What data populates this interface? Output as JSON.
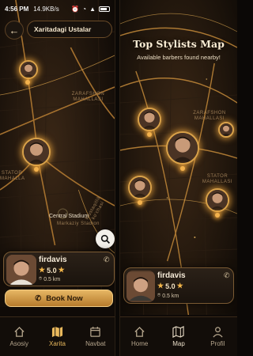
{
  "left_screen": {
    "status": {
      "time": "4:56 PM",
      "network": "14.9KB/s",
      "icons": [
        "alarm-icon",
        "wifi-icon",
        "signal-icon",
        "battery-icon"
      ]
    },
    "header": {
      "back_icon": "arrow-left-icon",
      "title": "Xaritadagi Ustalar"
    },
    "map_labels": {
      "district1": "ZARAFSHON MAHALLASI",
      "district2": "STATOR MAHALLA",
      "stadium": "Central Stadium",
      "stadium_sub": "Markaziy Stadion",
      "street": "Mustaqillik ko'chasi"
    },
    "search_icon": "search-icon",
    "card": {
      "name": "firdavis",
      "rating": "5.0",
      "stars": "★★",
      "distance": "0.5 km",
      "phone_icon": "phone-icon",
      "pin_icon": "location-pin-icon"
    },
    "book_button": {
      "label": "Book Now",
      "icon": "phone-icon"
    },
    "nav": [
      {
        "label": "Asosiy",
        "icon": "home-icon",
        "active": false
      },
      {
        "label": "Xarita",
        "icon": "map-icon",
        "active": true
      },
      {
        "label": "Navbat",
        "icon": "calendar-icon",
        "active": false
      }
    ]
  },
  "right_screen": {
    "title": "Top Stylists Map",
    "subtitle": "Available barbers found nearby!",
    "map_labels": {
      "district1": "ZARAFSHON MAHALLASI",
      "district2": "STATOR MAHALLASI"
    },
    "card": {
      "name": "firdavis",
      "rating": "5.0",
      "stars": "★★",
      "distance": "0.5 km",
      "phone_icon": "phone-icon"
    },
    "nav": [
      {
        "label": "Home",
        "icon": "home-icon",
        "active": false
      },
      {
        "label": "Map",
        "icon": "map-icon",
        "active": true
      },
      {
        "label": "Profil",
        "icon": "person-icon",
        "active": false
      }
    ]
  },
  "colors": {
    "accent": "#e9b95d",
    "background": "#0b0806",
    "card_border": "#7a5a33",
    "glow": "#f3b24d"
  }
}
